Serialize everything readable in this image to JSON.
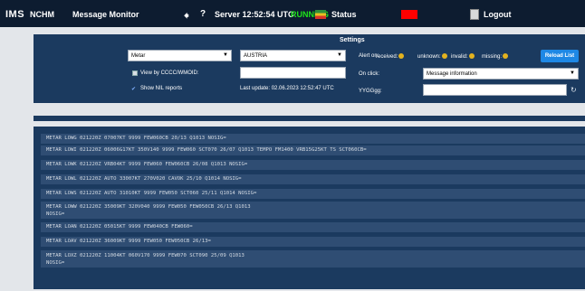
{
  "topbar": {
    "brand": "IMS",
    "station": "NCHM",
    "title": "Message Monitor",
    "server_label": "Server 12:52:54 UTC",
    "server_state": "RUNNING",
    "status_label": "Status",
    "logout_label": "Logout",
    "status_color": "#ff0000",
    "icons": [
      "back-arrow-icon",
      "help-icon",
      "flag-icon",
      "logout-icon"
    ]
  },
  "settings": {
    "heading": "Settings",
    "type_select": "Metar",
    "country_select": "AUSTRIA",
    "view_cccc_label": "View by CCCC/WMOID:",
    "show_nil_label": "Show NIL reports",
    "show_nil_checked": true,
    "last_update": "Last update: 02.06.2023 12:52:47 UTC",
    "alert_label": "Alert on:",
    "alert_received": "received:",
    "alert_unknown": "unknown:",
    "alert_invalid": "invalid:",
    "alert_missing": "missing:",
    "reload_label": "Reload List",
    "onclick_label": "On click:",
    "onclick_value": "Message information",
    "yyggg_label": "YYGGgg:"
  },
  "messages": [
    "METAR LOWG 021220Z 07007KT 9999 FEW060CB 20/13 Q1013 NOSIG=",
    "METAR LOWI 021220Z 06006G17KT 350V140 9999 FEW060 SCT070 26/07 Q1013 TEMPO FM1400 VRB15G25KT TS SCT060CB=",
    "METAR LOWK 021220Z VRB04KT 9999 FEW060 FEW060CB 26/08 Q1013 NOSIG=",
    "METAR LOWL 021220Z AUTO 33007KT 270V020 CAVOK 25/10 Q1014 NOSIG=",
    "METAR LOWS 021220Z AUTO 31010KT 9999 FEW050 SCT060 25/11 Q1014 NOSIG=",
    "METAR LOWW 021220Z 35009KT 320V040 9999 FEW050 FEW050CB 26/13 Q1013\nNOSIG=",
    "METAR LOAN 021220Z 05015KT 9999 FEW040CB FEW060=",
    "METAR LOAV 021220Z 36009KT 9999 FEW050 FEW050CB 26/13=",
    "METAR LOXZ 021220Z 11004KT 060V170 9999 FEW070 SCT090 25/09 Q1013\nNOSIG="
  ]
}
